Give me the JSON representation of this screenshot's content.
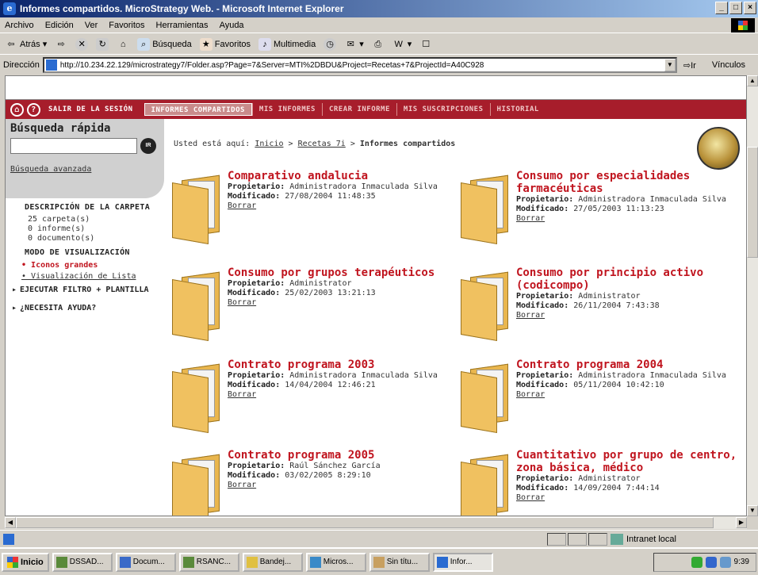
{
  "window": {
    "title": "Informes compartidos. MicroStrategy Web. - Microsoft Internet Explorer"
  },
  "menu": [
    "Archivo",
    "Edición",
    "Ver",
    "Favoritos",
    "Herramientas",
    "Ayuda"
  ],
  "toolbar": {
    "back": "Atrás",
    "search": "Búsqueda",
    "favorites": "Favoritos",
    "multimedia": "Multimedia"
  },
  "address": {
    "label": "Dirección",
    "url": "http://10.234.22.129/microstrategy7/Folder.asp?Page=7&Server=MTI%2DBDU&Project=Recetas+7&ProjectId=A40C928",
    "go": "Ir",
    "links": "Vínculos"
  },
  "nav": {
    "logout": "SALIR DE LA SESIÓN",
    "tabs": [
      "INFORMES COMPARTIDOS",
      "MIS INFORMES",
      "CREAR INFORME",
      "MIS SUSCRIPCIONES",
      "HISTORIAL"
    ]
  },
  "sidebar": {
    "quick_title": "Búsqueda rápida",
    "go_label": "IR",
    "advanced": "Búsqueda avanzada",
    "folder_desc_title": "DESCRIPCIÓN DE LA CARPETA",
    "stats": [
      "25 carpeta(s)",
      "0 informe(s)",
      "0 documento(s)"
    ],
    "view_mode_title": "MODO DE VISUALIZACIÓN",
    "view_options": [
      "Iconos grandes",
      "Visualización de Lista"
    ],
    "exec_filter": "EJECUTAR FILTRO + PLANTILLA",
    "help": "¿NECESITA AYUDA?"
  },
  "breadcrumb": {
    "prefix": "Usted está aquí:",
    "home": "Inicio",
    "sep": ">",
    "folder": "Recetas 7i",
    "current": "Informes compartidos"
  },
  "labels": {
    "owner": "Propietario:",
    "modified": "Modificado:",
    "delete": "Borrar"
  },
  "folders": [
    {
      "title": "Comparativo andalucia",
      "owner": "Administradora Inmaculada Silva",
      "modified": "27/08/2004 11:48:35"
    },
    {
      "title": "Consumo por especialidades farmacéuticas",
      "owner": "Administradora Inmaculada Silva",
      "modified": "27/05/2003 11:13:23"
    },
    {
      "title": "Consumo por grupos terapéuticos",
      "owner": "Administrator",
      "modified": "25/02/2003 13:21:13"
    },
    {
      "title": "Consumo por principio activo (codicompo)",
      "owner": "Administrator",
      "modified": "26/11/2004 7:43:38"
    },
    {
      "title": "Contrato programa 2003",
      "owner": "Administradora Inmaculada Silva",
      "modified": "14/04/2004 12:46:21"
    },
    {
      "title": "Contrato programa 2004",
      "owner": "Administradora Inmaculada Silva",
      "modified": "05/11/2004 10:42:10"
    },
    {
      "title": "Contrato programa 2005",
      "owner": "Raúl Sánchez García",
      "modified": "03/02/2005 8:29:10"
    },
    {
      "title": "Cuantitativo por grupo de centro, zona básica, médico",
      "owner": "Administrator",
      "modified": "14/09/2004 7:44:14"
    }
  ],
  "status": {
    "zone": "Intranet local"
  },
  "taskbar": {
    "start": "Inicio",
    "tasks": [
      "DSSAD...",
      "Docum...",
      "RSANC...",
      "Bandej...",
      "Micros...",
      "Sin títu...",
      "Infor..."
    ],
    "clock": "9:39"
  }
}
